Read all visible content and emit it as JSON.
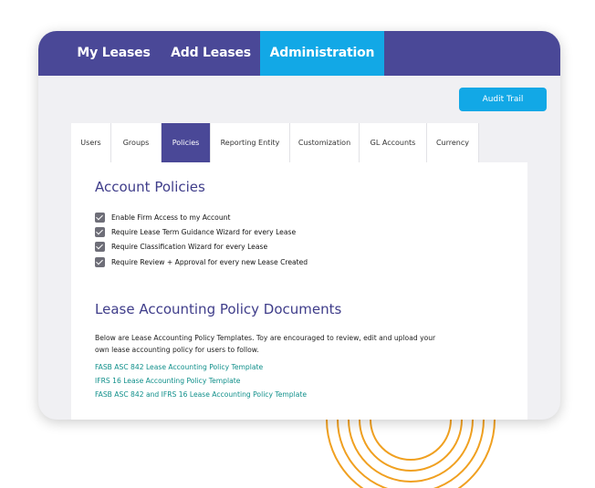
{
  "colors": {
    "nav_bg": "#4a4897",
    "nav_active": "#12a8e6",
    "link": "#0f8f8a",
    "heading": "#3f3d8a",
    "arc": "#f0a020"
  },
  "topnav": {
    "tabs": [
      {
        "label": "My Leases",
        "active": false
      },
      {
        "label": "Add Leases",
        "active": false
      },
      {
        "label": "Administration",
        "active": true
      }
    ]
  },
  "toolbar": {
    "audit_trail_label": "Audit Trail"
  },
  "subtabs": [
    {
      "label": "Users",
      "active": false
    },
    {
      "label": "Groups",
      "active": false
    },
    {
      "label": "Policies",
      "active": true
    },
    {
      "label": "Reporting Entity",
      "active": false
    },
    {
      "label": "Customization",
      "active": false
    },
    {
      "label": "GL Accounts",
      "active": false
    },
    {
      "label": "Currency",
      "active": false
    }
  ],
  "account_policies": {
    "title": "Account Policies",
    "items": [
      {
        "label": "Enable Firm Access to my Account",
        "checked": true
      },
      {
        "label": "Require Lease Term Guidance Wizard for every Lease",
        "checked": true
      },
      {
        "label": "Require Classification Wizard for every Lease",
        "checked": true
      },
      {
        "label": "Require Review + Approval for every new Lease Created",
        "checked": true
      }
    ]
  },
  "policy_documents": {
    "title": "Lease Accounting Policy Documents",
    "description": "Below are Lease Accounting Policy Templates. Toy are encouraged to review, edit and upload your own lease accounting policy for users to follow.",
    "links": [
      "FASB ASC 842 Lease Accounting Policy Template",
      "IFRS 16 Lease Accounting Policy Template",
      "FASB ASC 842 and IFRS 16 Lease Accounting Policy Template"
    ]
  }
}
